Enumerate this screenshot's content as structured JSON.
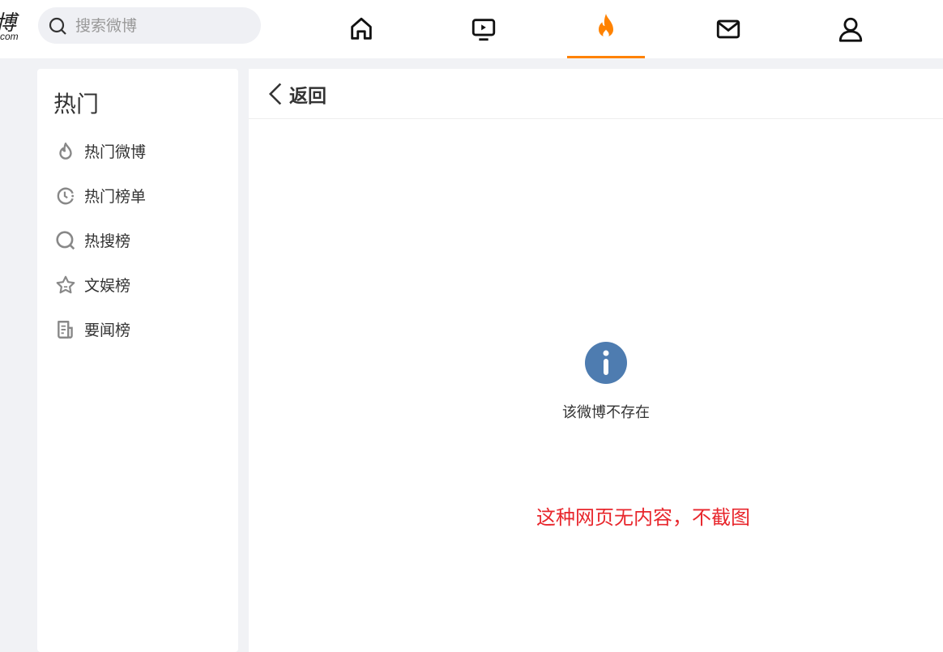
{
  "logo": {
    "text": "博",
    "domain": "com"
  },
  "search": {
    "placeholder": "搜索微博"
  },
  "nav": [
    {
      "icon": "home-icon"
    },
    {
      "icon": "video-icon"
    },
    {
      "icon": "hot-flame-icon",
      "active": true
    },
    {
      "icon": "mail-icon"
    },
    {
      "icon": "user-icon"
    }
  ],
  "colors": {
    "accent": "#ff8200",
    "info": "#4e7cb0",
    "note": "#e8262c"
  },
  "sidebar": {
    "title": "热门",
    "items": [
      {
        "label": "热门微博",
        "icon": "flame-icon"
      },
      {
        "label": "热门榜单",
        "icon": "clock-icon"
      },
      {
        "label": "热搜榜",
        "icon": "search-icon"
      },
      {
        "label": "文娱榜",
        "icon": "star-icon"
      },
      {
        "label": "要闻榜",
        "icon": "news-icon"
      }
    ]
  },
  "main": {
    "back_label": "返回",
    "message": "该微博不存在",
    "note": "这种网页无内容，不截图"
  }
}
